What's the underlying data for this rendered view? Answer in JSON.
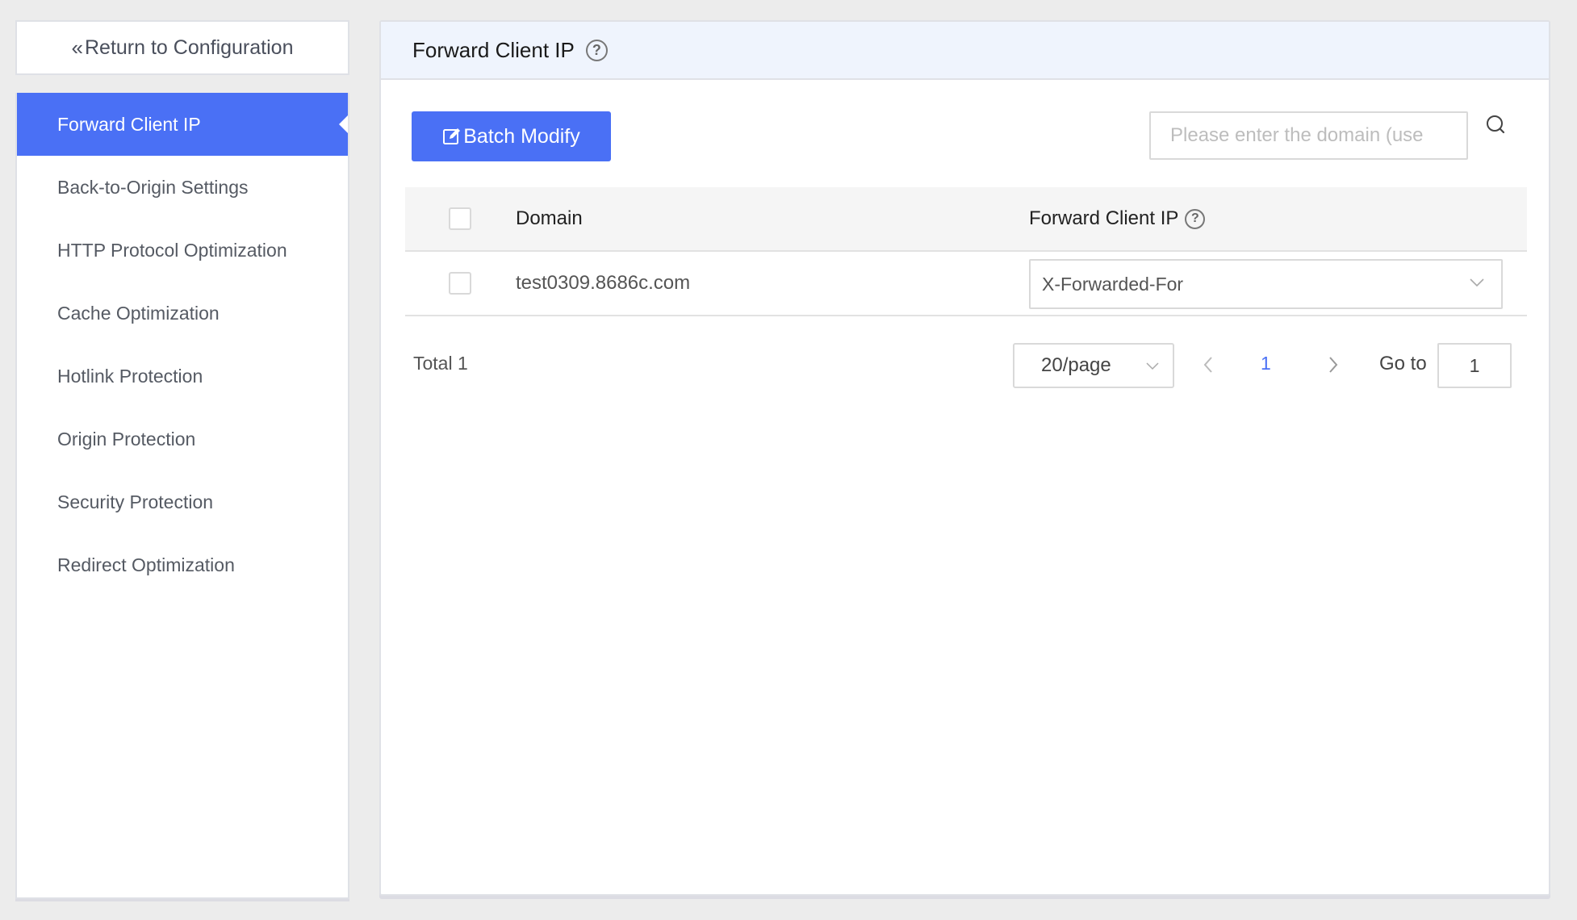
{
  "sidebar": {
    "return_label": "Return to Configuration",
    "items": [
      {
        "label": "Forward Client IP",
        "active": true
      },
      {
        "label": "Back-to-Origin Settings",
        "active": false
      },
      {
        "label": "HTTP Protocol Optimization",
        "active": false
      },
      {
        "label": "Cache Optimization",
        "active": false
      },
      {
        "label": "Hotlink Protection",
        "active": false
      },
      {
        "label": "Origin Protection",
        "active": false
      },
      {
        "label": "Security Protection",
        "active": false
      },
      {
        "label": "Redirect Optimization",
        "active": false
      }
    ]
  },
  "main": {
    "title": "Forward Client IP",
    "help_glyph": "?",
    "toolbar": {
      "batch_modify_label": "Batch Modify",
      "search_placeholder": "Please enter the domain (use",
      "search_value": ""
    },
    "table": {
      "columns": [
        "Domain",
        "Forward Client IP"
      ],
      "rows": [
        {
          "domain": "test0309.8686c.com",
          "forward_client_ip": "X-Forwarded-For",
          "checked": false
        }
      ]
    },
    "pagination": {
      "total_label": "Total 1",
      "page_size": "20/page",
      "current_page": "1",
      "goto_label": "Go to",
      "goto_value": "1"
    }
  },
  "colors": {
    "accent": "#4a70f5",
    "header_bg": "#eff4fd",
    "page_bg": "#ececec"
  }
}
